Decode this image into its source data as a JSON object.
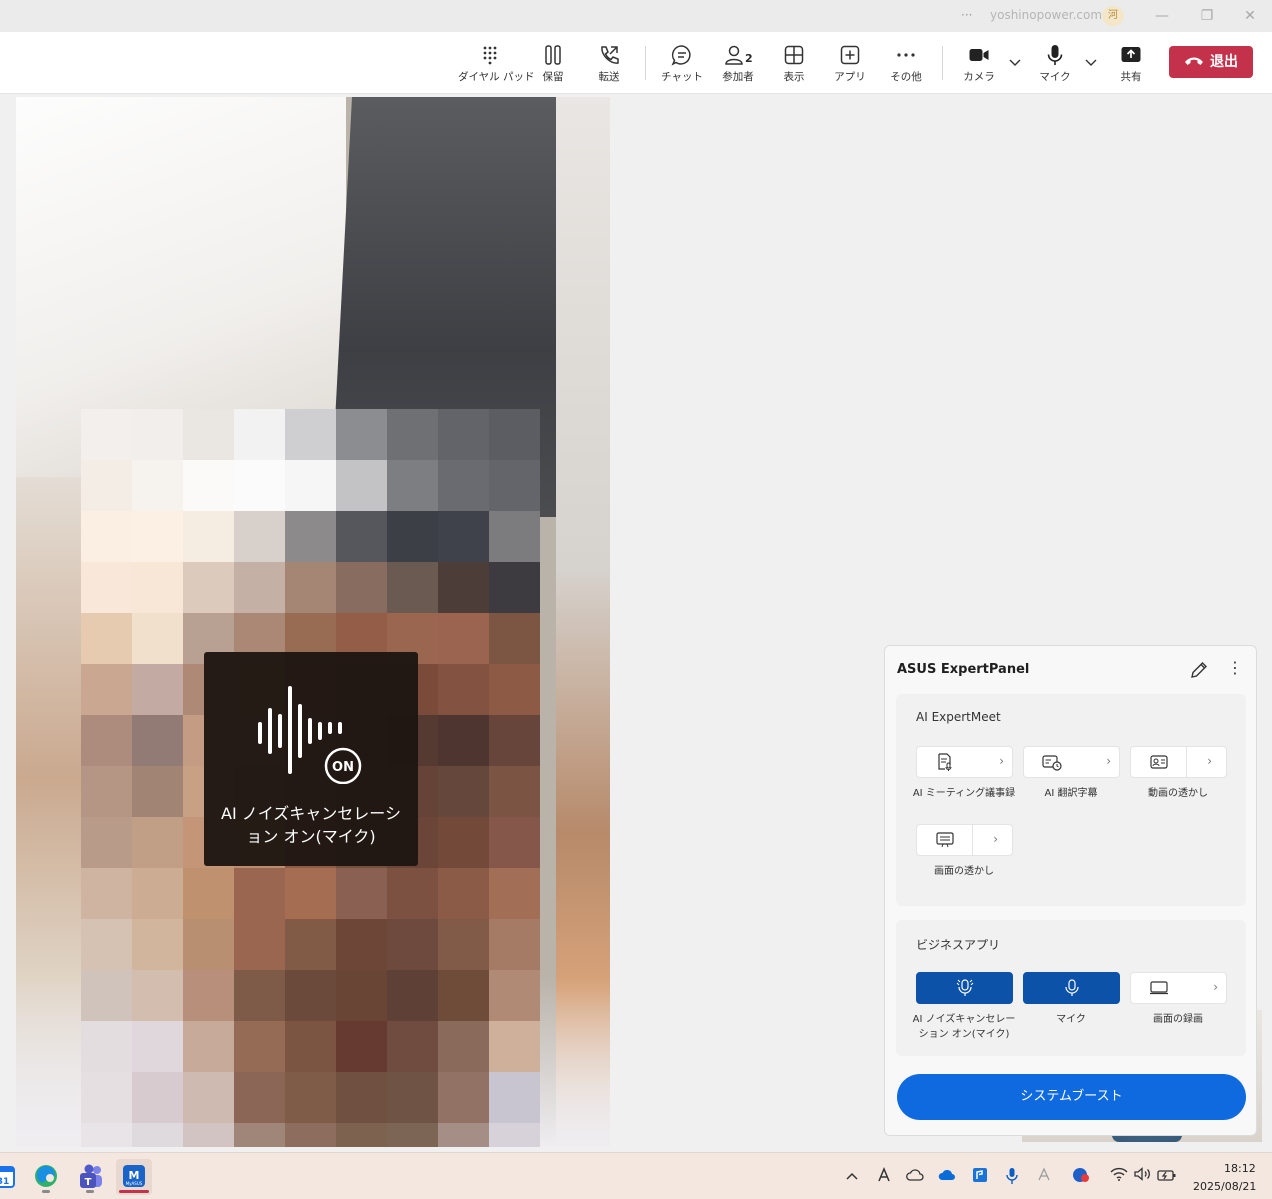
{
  "titlebar": {
    "more": "···",
    "account": "yoshinopower.com",
    "avatar": "河",
    "controls": [
      "minimize-icon",
      "restore-icon",
      "close-icon"
    ]
  },
  "toolbar": {
    "dialpad": "ダイヤル パッド",
    "hold": "保留",
    "transfer": "転送",
    "chat": "チャット",
    "participants": "参加者",
    "participants_count": "2",
    "view": "表示",
    "apps": "アプリ",
    "more": "その他",
    "camera": "カメラ",
    "mic": "マイク",
    "share": "共有",
    "leave": "退出",
    "leave_color": "#c4314b"
  },
  "video": {
    "overlay_text": "AI ノイズキャンセレーション オン(マイク)",
    "overlay_badge": "ON"
  },
  "panel": {
    "title": "ASUS ExpertPanel",
    "section1": {
      "title": "AI ExpertMeet",
      "items": [
        {
          "label": "AI ミーティング議事録",
          "icon": "meeting-notes-icon"
        },
        {
          "label": "AI 翻訳字幕",
          "icon": "translation-subtitle-icon"
        },
        {
          "label": "動画の透かし",
          "icon": "video-watermark-icon"
        },
        {
          "label": "画面の透かし",
          "icon": "screen-watermark-icon"
        }
      ]
    },
    "section2": {
      "title": "ビジネスアプリ",
      "items": [
        {
          "label": "AI ノイズキャンセレーション オン(マイク)",
          "icon": "ai-noise-cancel-icon",
          "state": "on"
        },
        {
          "label": "マイク",
          "icon": "microphone-icon",
          "state": "on"
        },
        {
          "label": "画面の録画",
          "icon": "screen-record-icon",
          "state": "off"
        }
      ]
    },
    "boost": "システムブースト",
    "accent": "#0b52a8"
  },
  "taskbar": {
    "apps": [
      "calendar-app-icon",
      "edge-browser-icon",
      "teams-app-icon",
      "myasus-app-icon"
    ],
    "myasus_label": "MyASUS",
    "time": "18:12",
    "date": "2025/08/21"
  }
}
